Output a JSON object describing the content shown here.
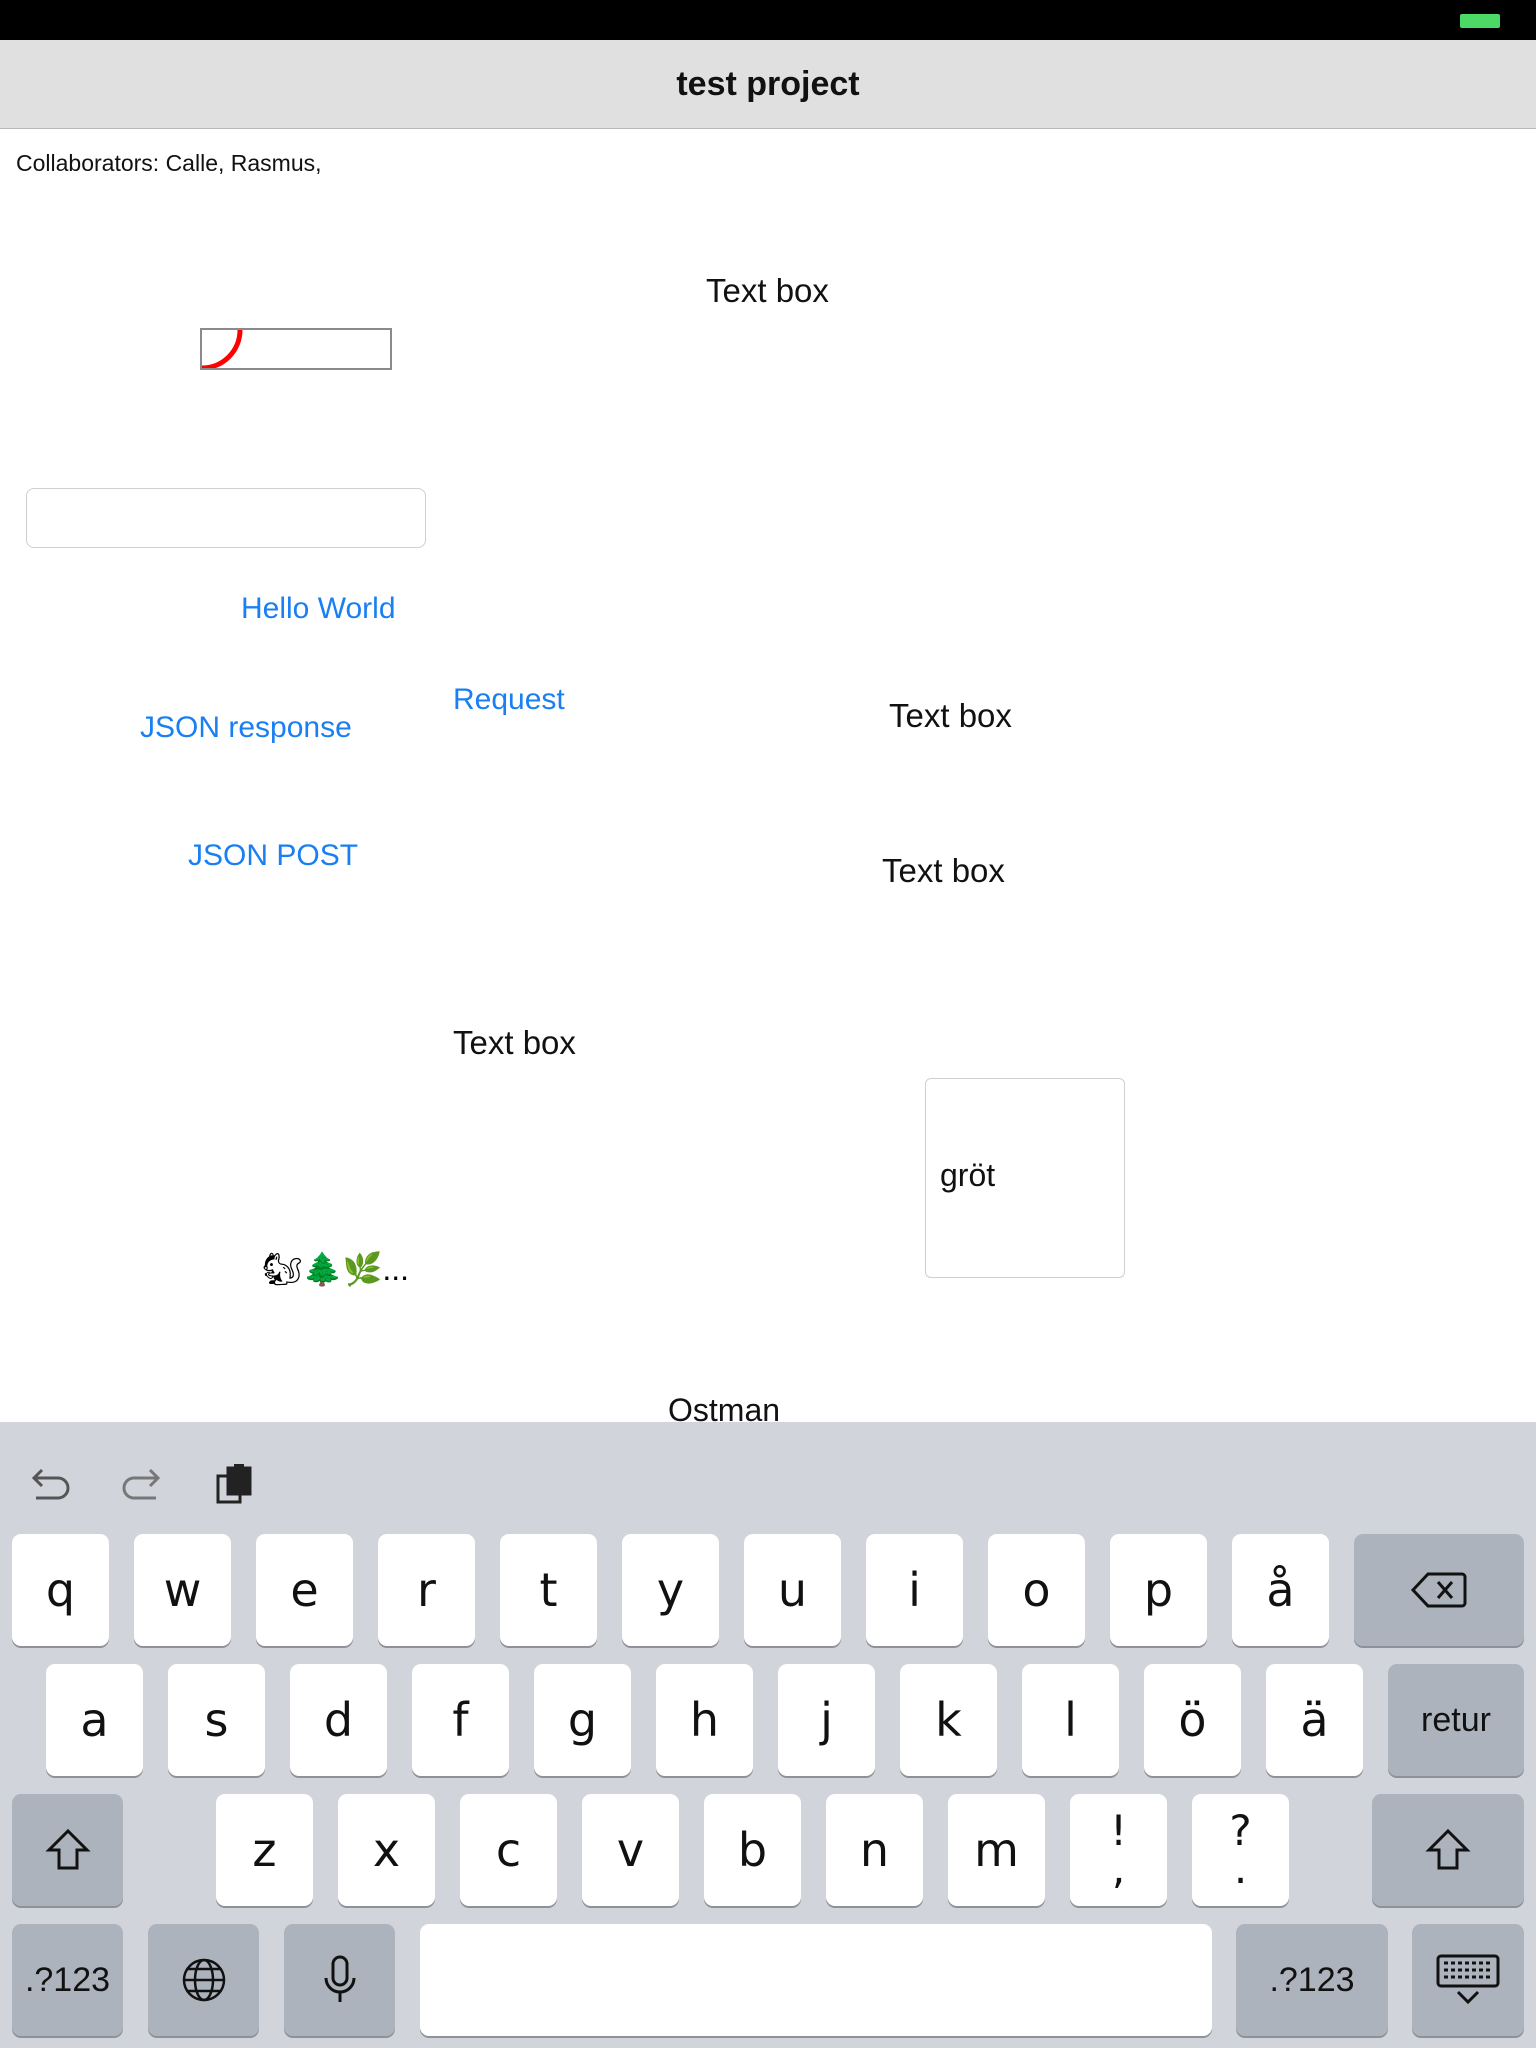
{
  "nav": {
    "title": "test project"
  },
  "canvas": {
    "collaborators": "Collaborators: Calle, Rasmus,",
    "textbox_1": "Text box",
    "textbox_2": "Text box",
    "textbox_3": "Text box",
    "textbox_4": "Text box",
    "link_hello": "Hello World",
    "link_request": "Request",
    "link_json_response": "JSON response",
    "link_json_post": "JSON POST",
    "grot_text": "gröt",
    "emoji_text": "🐿🌲🌿...",
    "ostman": "Ostman",
    "accent_color": "#1a7ff2",
    "progress_color": "#ff0000"
  },
  "keyboard": {
    "toolbar": [
      "undo-icon",
      "redo-icon",
      "paste-icon"
    ],
    "row1": [
      "q",
      "w",
      "e",
      "r",
      "t",
      "y",
      "u",
      "i",
      "o",
      "p",
      "å"
    ],
    "row2": [
      "a",
      "s",
      "d",
      "f",
      "g",
      "h",
      "j",
      "k",
      "l",
      "ö",
      "ä"
    ],
    "return_label": "retur",
    "row3": [
      "z",
      "x",
      "c",
      "v",
      "b",
      "n",
      "m"
    ],
    "punct1_top": "!",
    "punct1_bottom": ",",
    "punct2_top": "?",
    "punct2_bottom": ".",
    "numbers_label": ".?123",
    "numbers_label_right": ".?123"
  }
}
